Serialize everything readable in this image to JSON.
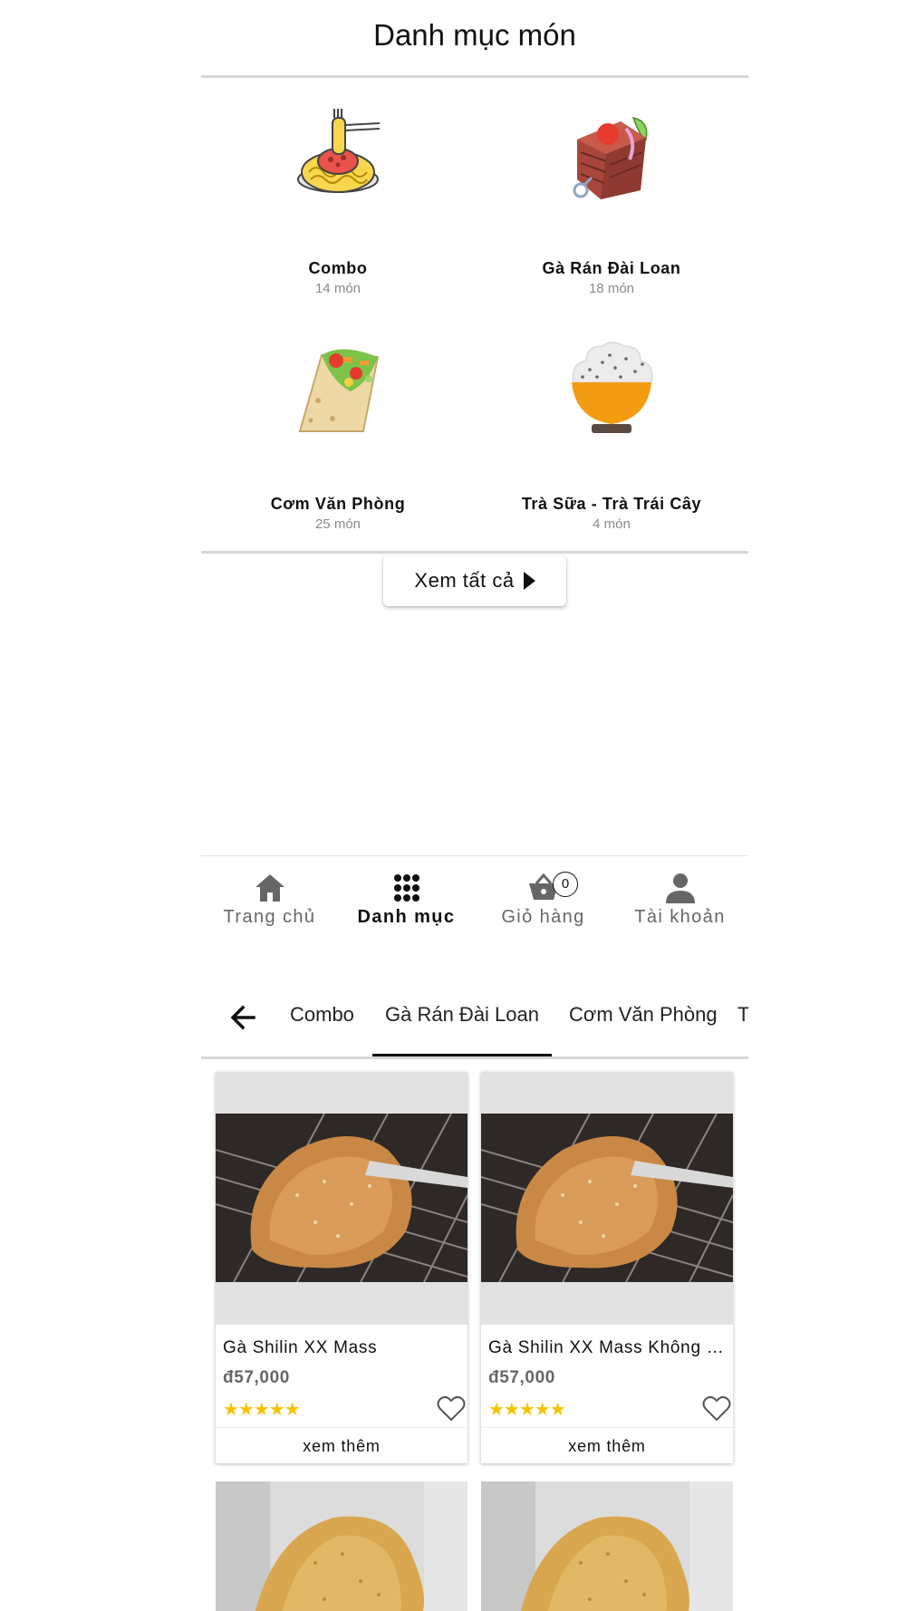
{
  "header": {
    "title": "Danh mục món"
  },
  "categories": [
    {
      "name": "Combo",
      "count": "14 món",
      "icon": "spaghetti-icon"
    },
    {
      "name": "Gà Rán Đài Loan",
      "count": "18 món",
      "icon": "meat-skewer-icon"
    },
    {
      "name": "Cơm Văn Phòng",
      "count": "25 món",
      "icon": "burrito-icon"
    },
    {
      "name": "Trà Sữa - Trà Trái Cây",
      "count": "4 món",
      "icon": "rice-bowl-icon"
    }
  ],
  "see_all": {
    "label": "Xem tất cả"
  },
  "bottom_nav": {
    "items": [
      {
        "label": "Trang chủ",
        "icon": "home-icon"
      },
      {
        "label": "Danh mục",
        "icon": "grid-icon",
        "active": true
      },
      {
        "label": "Giỏ hàng",
        "icon": "basket-icon",
        "badge": "0"
      },
      {
        "label": "Tài khoản",
        "icon": "person-icon"
      }
    ]
  },
  "tabs": {
    "items": [
      "Combo",
      "Gà Rán Đài Loan",
      "Cơm Văn Phòng",
      "T"
    ],
    "active": "Gà Rán Đài Loan"
  },
  "products": [
    {
      "name": "Gà Shilin XX Mass",
      "price": "đ57,000",
      "stars": "★★★★★",
      "more": "xem thêm"
    },
    {
      "name": "Gà Shilin XX Mass Không Xương",
      "price": "đ57,000",
      "stars": "★★★★★",
      "more": "xem thêm"
    }
  ],
  "colors": {
    "star": "#f5c400",
    "accent": "#111111",
    "divider": "#d6d6d6"
  }
}
